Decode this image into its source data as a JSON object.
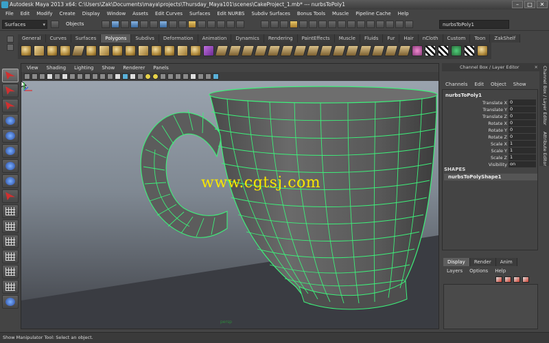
{
  "window": {
    "title": "Autodesk Maya 2013 x64: C:\\Users\\Zak\\Documents\\maya\\projects\\Thursday_Maya101\\scenes\\CakeProject_1.mb*  ---  nurbsToPoly1",
    "controls": [
      "–",
      "□",
      "✕"
    ]
  },
  "menubar": [
    "File",
    "Edit",
    "Modify",
    "Create",
    "Display",
    "Window",
    "Assets",
    "Edit Curves",
    "Surfaces",
    "Edit NURBS",
    "Subdiv Surfaces",
    "Bonus Tools",
    "Muscle",
    "Pipeline Cache",
    "Help"
  ],
  "statusline": {
    "mode": "Surfaces",
    "selection_mask": "Objects",
    "name_field": "nurbsToPoly1"
  },
  "shelf": {
    "tabs": [
      "General",
      "Curves",
      "Surfaces",
      "Polygons",
      "Subdivs",
      "Deformation",
      "Animation",
      "Dynamics",
      "Rendering",
      "PaintEffects",
      "Muscle",
      "Fluids",
      "Fur",
      "Hair",
      "nCloth",
      "Custom",
      "Toon",
      "ZakShelf"
    ],
    "active_tab": "Polygons"
  },
  "viewport": {
    "menu": [
      "View",
      "Shading",
      "Lighting",
      "Show",
      "Renderer",
      "Panels"
    ],
    "watermark": "www.cgtsj.com",
    "camera_label": "persp",
    "wire_color": "#3df07a"
  },
  "channel_box": {
    "header": "Channel Box / Layer Editor",
    "menu": [
      "Channels",
      "Edit",
      "Object",
      "Show"
    ],
    "node": "nurbsToPoly1",
    "attributes": [
      {
        "label": "Translate X",
        "value": "0"
      },
      {
        "label": "Translate Y",
        "value": "0"
      },
      {
        "label": "Translate Z",
        "value": "0"
      },
      {
        "label": "Rotate X",
        "value": "0"
      },
      {
        "label": "Rotate Y",
        "value": "0"
      },
      {
        "label": "Rotate Z",
        "value": "0"
      },
      {
        "label": "Scale X",
        "value": "1"
      },
      {
        "label": "Scale Y",
        "value": "1"
      },
      {
        "label": "Scale Z",
        "value": "1"
      },
      {
        "label": "Visibility",
        "value": "on"
      }
    ],
    "shapes_label": "SHAPES",
    "shape_node": "nurbsToPolyShape1"
  },
  "side_tabs": [
    "Channel Box / Layer Editor",
    "Attribute Editor"
  ],
  "layer_editor": {
    "tabs": [
      "Display",
      "Render",
      "Anim"
    ],
    "active_tab": "Display",
    "menu": [
      "Layers",
      "Options",
      "Help"
    ]
  },
  "helpline": "Show Manipulator Tool: Select an object."
}
